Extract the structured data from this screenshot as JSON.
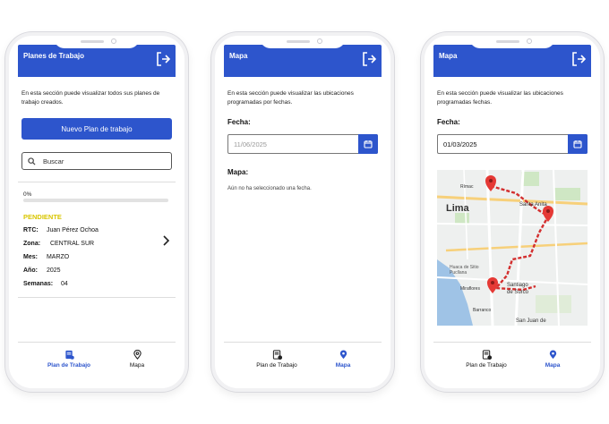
{
  "screen1": {
    "header_title": "Planes de Trabajo",
    "description": "En esta sección puede visualizar todos sus planes de trabajo creados.",
    "new_button_label": "Nuevo Plan de trabajo",
    "search_placeholder": "Buscar",
    "plan": {
      "progress_label": "0%",
      "progress": 0,
      "status": "PENDIENTE",
      "fields": [
        {
          "key": "RTC:",
          "value": "Juan Pérez Ochoa"
        },
        {
          "key": "Zona:",
          "value": "CENTRAL SUR"
        },
        {
          "key": "Mes:",
          "value": "MARZO"
        },
        {
          "key": "Año:",
          "value": "2025"
        },
        {
          "key": "Semanas:",
          "value": "04"
        }
      ]
    },
    "tabs": {
      "plan": "Plan de Trabajo",
      "map": "Mapa"
    }
  },
  "screen2": {
    "header_title": "Mapa",
    "description": "En esta sección puede visualizar las ubicaciones programadas por fechas.",
    "date_label": "Fecha:",
    "date_placeholder": "11/06/2025",
    "map_label": "Mapa:",
    "empty_note": "Aún no ha seleccionado una fecha.",
    "tabs": {
      "plan": "Plan de Trabajo",
      "map": "Mapa"
    }
  },
  "screen3": {
    "header_title": "Mapa",
    "description": "En esta sección puede visualizar las ubicaciones programadas fechas.",
    "date_label": "Fecha:",
    "date_value": "01/03/2025",
    "map_labels": {
      "city": "Lima",
      "rimac": "Rímac",
      "santa_anita": "Santa Anita",
      "surco_1": "Santiago",
      "surco_2": "de Surco",
      "miraflores": "Miraflores",
      "barranco": "Barranco",
      "san_juan": "San Juan de",
      "huaca_1": "Huaca de Sitio",
      "huaca_2": "Pucllana"
    },
    "tabs": {
      "plan": "Plan de Trabajo",
      "map": "Mapa"
    }
  },
  "colors": {
    "primary": "#2d55cc",
    "pending": "#d9c600",
    "marker": "#e53935"
  }
}
